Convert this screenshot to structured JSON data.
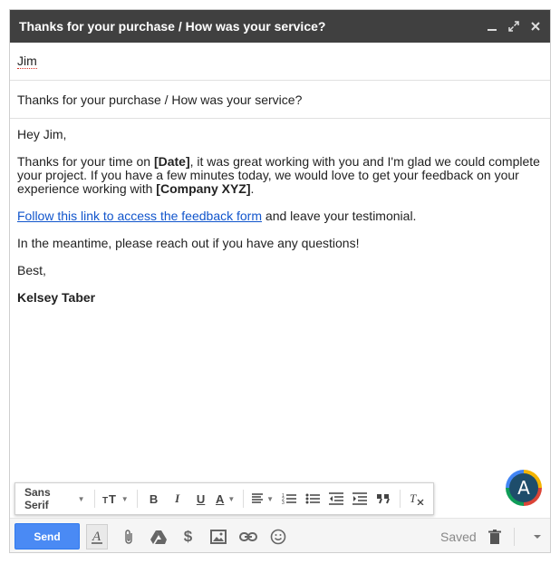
{
  "window": {
    "title": "Thanks for your purchase / How was your service?",
    "controls": [
      "minimize-icon",
      "expand-icon",
      "close-icon"
    ]
  },
  "recipients": {
    "to": "Jim"
  },
  "subject": "Thanks for your purchase / How was your service?",
  "message": {
    "greeting": "Hey Jim,",
    "p1_a": "Thanks for your time on ",
    "p1_date": "[Date]",
    "p1_b": ", it was great working with you and I'm glad we could complete your project. If you have a few minutes today, we would love to get your feedback on your experience working with ",
    "p1_company": "[Company XYZ]",
    "p1_c": ".",
    "link_text": "Follow this link to access the feedback form",
    "p2_rest": " and leave your testimonial.",
    "p3": "In the meantime, please reach out if you have any questions!",
    "signoff": "Best,",
    "signature": "Kelsey Taber"
  },
  "avatar": {
    "letter": "A"
  },
  "formatting_toolbar": {
    "font": "Sans Serif",
    "bold": "B",
    "italic": "I",
    "underline": "U",
    "text_color": "A"
  },
  "bottom_toolbar": {
    "send_label": "Send",
    "saved_label": "Saved"
  },
  "colors": {
    "titlebar": "#404040",
    "send": "#4a8af4",
    "link": "#1155cc"
  }
}
